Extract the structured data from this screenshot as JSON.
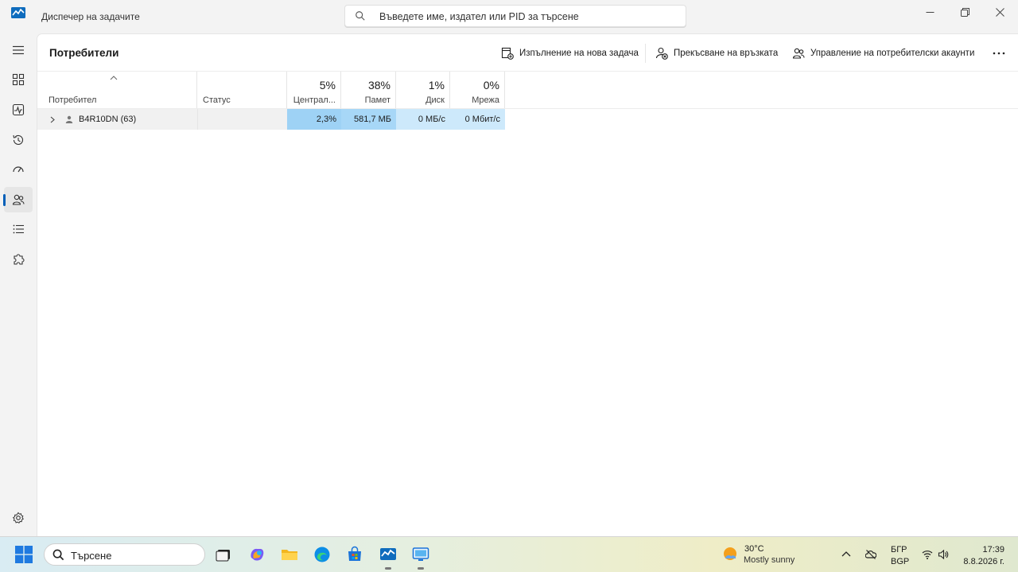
{
  "window": {
    "title": "Диспечер на задачите",
    "search_placeholder": "Въведете име, издател или PID за търсене"
  },
  "nav": {
    "items": [
      "menu",
      "processes",
      "performance",
      "app-history",
      "startup-apps",
      "users",
      "details",
      "services"
    ],
    "active": "users",
    "settings": "settings"
  },
  "page": {
    "title": "Потребители"
  },
  "commands": {
    "run_new_task": "Изпълнение на нова задача",
    "disconnect": "Прекъсване на връзката",
    "manage_accounts": "Управление на потребителски акаунти"
  },
  "table": {
    "columns": {
      "user": "Потребител",
      "status": "Статус",
      "cpu_pct": "5%",
      "cpu": "Централ...",
      "mem_pct": "38%",
      "mem": "Памет",
      "disk_pct": "1%",
      "disk": "Диск",
      "net_pct": "0%",
      "net": "Мрежа"
    },
    "rows": [
      {
        "user": "B4R10DN (63)",
        "status": "",
        "cpu": "2,3%",
        "mem": "581,7 МБ",
        "disk": "0 МБ/с",
        "net": "0 Мбит/с"
      }
    ]
  },
  "taskbar": {
    "search": "Търсене",
    "weather_temp": "30°C",
    "weather_desc": "Mostly sunny",
    "lang_top": "БГР",
    "lang_bottom": "BGP",
    "time": "17:39",
    "date": "8.8.2026 г."
  },
  "colors": {
    "accent": "#005fb8",
    "cpu_heat": "#9ed2f5",
    "mem_heat": "#a7d7f7",
    "disk_heat": "#cde9fb"
  }
}
